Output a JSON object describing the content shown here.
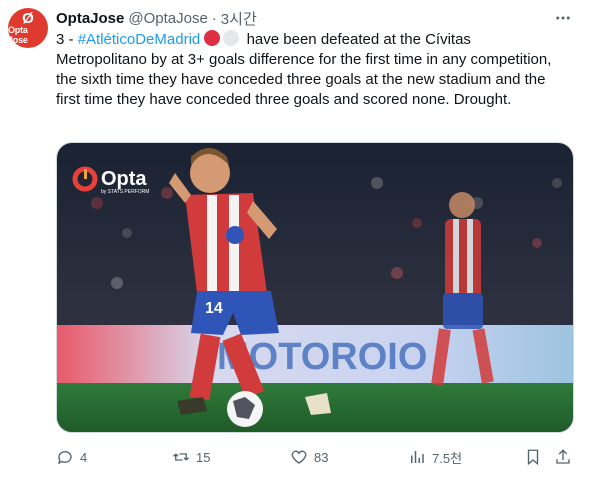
{
  "author": {
    "avatar_text": "Opta Jose",
    "name": "OptaJose",
    "handle": "@OptaJose",
    "separator": "·",
    "time": "3시간"
  },
  "tweet": {
    "text_before": "3 - ",
    "hashtag": "#AtléticoDeMadrid",
    "text_after": " have been defeated at the Cívitas Metropolitano by at 3+ goals difference for the first time in any competition, the sixth time they have conceded three goals at the new stadium and the first time they have conceded three goals and scored none. Drought.",
    "emojis": [
      "red-circle",
      "white-circle"
    ]
  },
  "media": {
    "watermark": "Opta",
    "watermark_sub": "by STATS PERFORM",
    "player_number": "14",
    "board_text": "MOTOROIO"
  },
  "actions": {
    "reply_count": "4",
    "retweet_count": "15",
    "like_count": "83",
    "views_count": "7.5천"
  },
  "colors": {
    "accent": "#1d9bf0",
    "muted": "#536471",
    "brand_red": "#e03a2e"
  }
}
